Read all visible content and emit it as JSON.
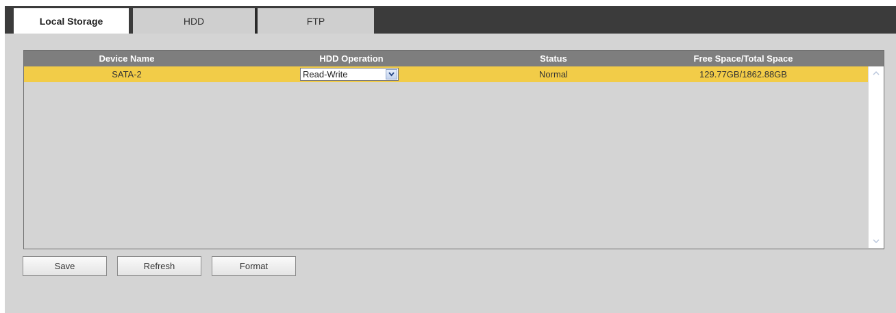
{
  "tabs": [
    {
      "label": "Local Storage"
    },
    {
      "label": "HDD"
    },
    {
      "label": "FTP"
    }
  ],
  "table": {
    "headers": [
      "Device Name",
      "HDD Operation",
      "Status",
      "Free Space/Total Space"
    ],
    "rows": [
      {
        "device": "SATA-2",
        "operation": "Read-Write",
        "status": "Normal",
        "space": "129.77GB/1862.88GB"
      }
    ]
  },
  "buttons": {
    "save": "Save",
    "refresh": "Refresh",
    "format": "Format"
  },
  "colors": {
    "selected_row": "#f2cc48",
    "header_bg": "#7e7e7e",
    "tabbar_bg": "#3b3b3b",
    "panel_bg": "#d4d4d4"
  },
  "icons": [
    "chevron-down-icon",
    "scroll-up-icon",
    "scroll-down-icon"
  ]
}
